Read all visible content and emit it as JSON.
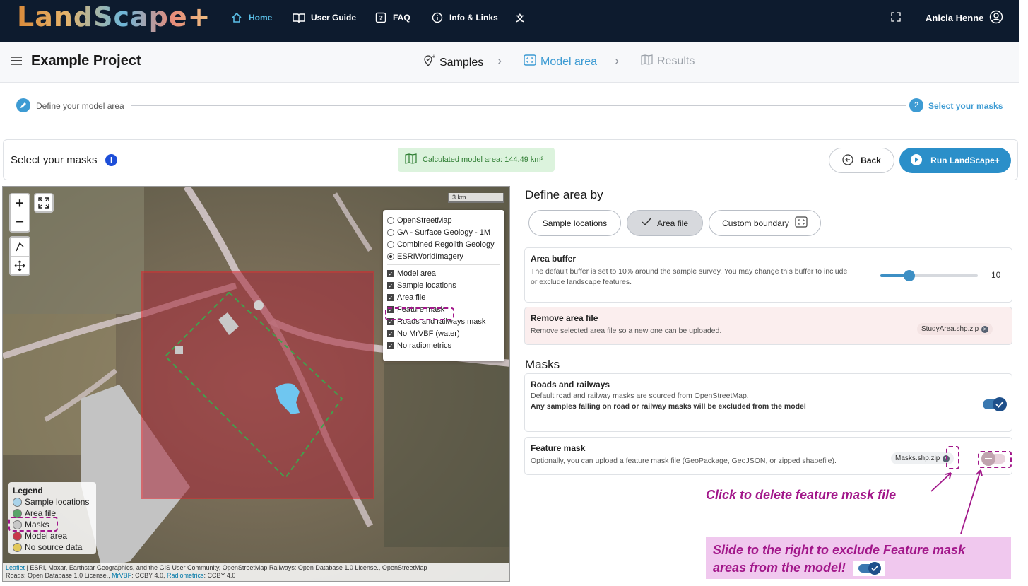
{
  "app": {
    "logo_text": "LandScape+",
    "nav": [
      {
        "label": "Home",
        "icon": "home-icon",
        "active": true
      },
      {
        "label": "User Guide",
        "icon": "book-icon"
      },
      {
        "label": "FAQ",
        "icon": "question-icon"
      },
      {
        "label": "Info & Links",
        "icon": "info-icon"
      }
    ],
    "user_name": "Anicia Henne"
  },
  "project": {
    "title": "Example Project",
    "steps": [
      {
        "label": "Samples",
        "state": "done"
      },
      {
        "label": "Model area",
        "state": "active"
      },
      {
        "label": "Results",
        "state": "disabled"
      }
    ]
  },
  "stepper": {
    "step1_label": "Define your model area",
    "step2_number": "2",
    "step2_label": "Select your masks"
  },
  "mask_bar": {
    "title": "Select your masks",
    "info": "i",
    "calc_area": "Calculated model area:  144.49 km²",
    "back": "Back",
    "run": "Run LandScape+"
  },
  "map": {
    "scale": "3 km",
    "base_layers": [
      {
        "label": "OpenStreetMap",
        "selected": false
      },
      {
        "label": "GA - Surface Geology - 1M",
        "selected": false
      },
      {
        "label": "Combined Regolith Geology",
        "selected": false
      },
      {
        "label": "ESRIWorldImagery",
        "selected": true
      }
    ],
    "overlays": [
      {
        "label": "Model area",
        "checked": true
      },
      {
        "label": "Sample locations",
        "checked": true
      },
      {
        "label": "Area file",
        "checked": true
      },
      {
        "label": "Feature mask",
        "checked": true
      },
      {
        "label": "Roads and railways mask",
        "checked": true
      },
      {
        "label": "No MrVBF (water)",
        "checked": true
      },
      {
        "label": "No radiometrics",
        "checked": true
      }
    ],
    "legend": {
      "title": "Legend",
      "items": [
        {
          "label": "Sample locations",
          "color": "#a9d3ea"
        },
        {
          "label": "Area file",
          "color": "#5aa469"
        },
        {
          "label": "Masks",
          "color": "#c8c8c8"
        },
        {
          "label": "Model area",
          "color": "#c8374a"
        },
        {
          "label": "No source data",
          "color": "#e2c85a"
        }
      ]
    },
    "attribution_line1_a": "Leaflet",
    "attribution_line1_b": " | ESRI, Maxar, Earthstar Geographics, and the GIS User Community, OpenStreetMap Railways: Open Database 1.0 License., OpenStreetMap",
    "attribution_line2_a": "Roads: Open Database 1.0 License., ",
    "attribution_line2_b": "MrVBF",
    "attribution_line2_c": ": CCBY 4.0, ",
    "attribution_line2_d": "Radiometrics",
    "attribution_line2_e": ": CCBY 4.0"
  },
  "define_area": {
    "heading": "Define area by",
    "options": [
      "Sample locations",
      "Area file",
      "Custom boundary"
    ],
    "selected": "Area file"
  },
  "area_buffer": {
    "title": "Area buffer",
    "desc": "The default buffer is set to 10% around the sample survey. You may change this buffer to include or exclude landscape features.",
    "value": 10,
    "slider_fraction": 0.3
  },
  "remove_area": {
    "title": "Remove area file",
    "desc": "Remove selected area file so a new one can be uploaded.",
    "file": "StudyArea.shp.zip"
  },
  "masks": {
    "heading": "Masks",
    "roads": {
      "title": "Roads and railways",
      "desc": "Default road and railway masks are sourced from OpenStreetMap.",
      "bold": "Any samples falling on road or railway masks will be excluded from the model",
      "enabled": true
    },
    "feature": {
      "title": "Feature mask",
      "desc": "Optionally, you can upload a feature mask file (GeoPackage, GeoJSON, or zipped shapefile).",
      "file": "Masks.shp.zip",
      "enabled": false
    }
  },
  "annotations": {
    "delete_hint": "Click to delete feature mask file",
    "slide_hint_line1": "Slide to the right to exclude Feature mask",
    "slide_hint_line2": "areas from the model!",
    "accent": "#a2178a"
  }
}
